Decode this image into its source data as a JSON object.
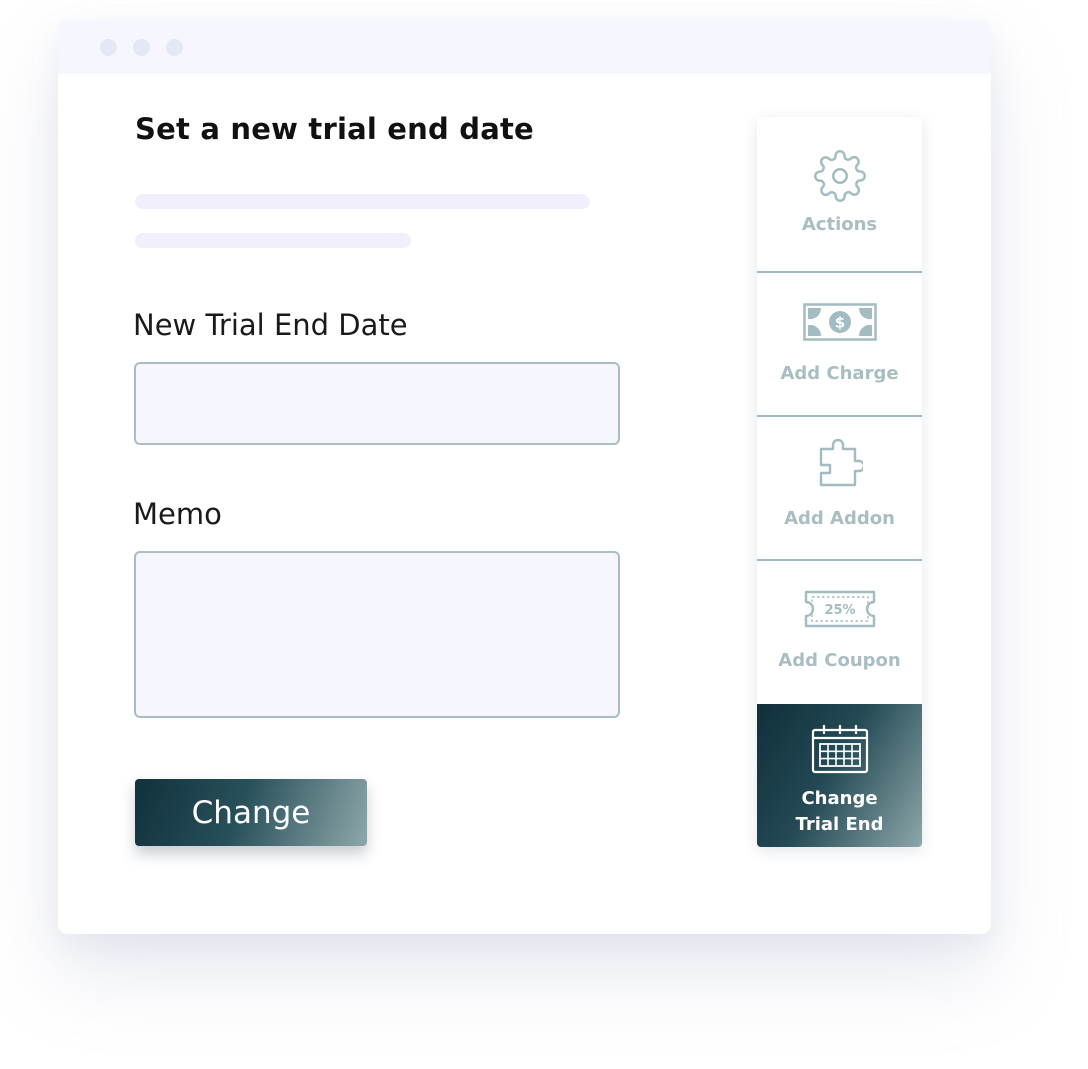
{
  "form": {
    "title": "Set a new trial end date",
    "date_label": "New Trial End Date",
    "date_value": "",
    "memo_label": "Memo",
    "memo_value": "",
    "submit_label": "Change"
  },
  "actions_panel": {
    "items": [
      {
        "label": "Actions",
        "icon": "gear-icon",
        "active": false
      },
      {
        "label": "Add Charge",
        "icon": "money-bill-icon",
        "active": false
      },
      {
        "label": "Add Addon",
        "icon": "puzzle-piece-icon",
        "active": false
      },
      {
        "label": "Add Coupon",
        "icon": "coupon-icon",
        "icon_text": "25%",
        "active": false
      },
      {
        "label": "Change Trial End",
        "icon": "calendar-icon",
        "active": true
      }
    ]
  },
  "colors": {
    "accent_dark": "#10313d",
    "accent_light": "#8ea7aa",
    "muted_label": "#a9bec2",
    "input_bg": "#f6f7fe",
    "input_border": "#a8bec3"
  }
}
